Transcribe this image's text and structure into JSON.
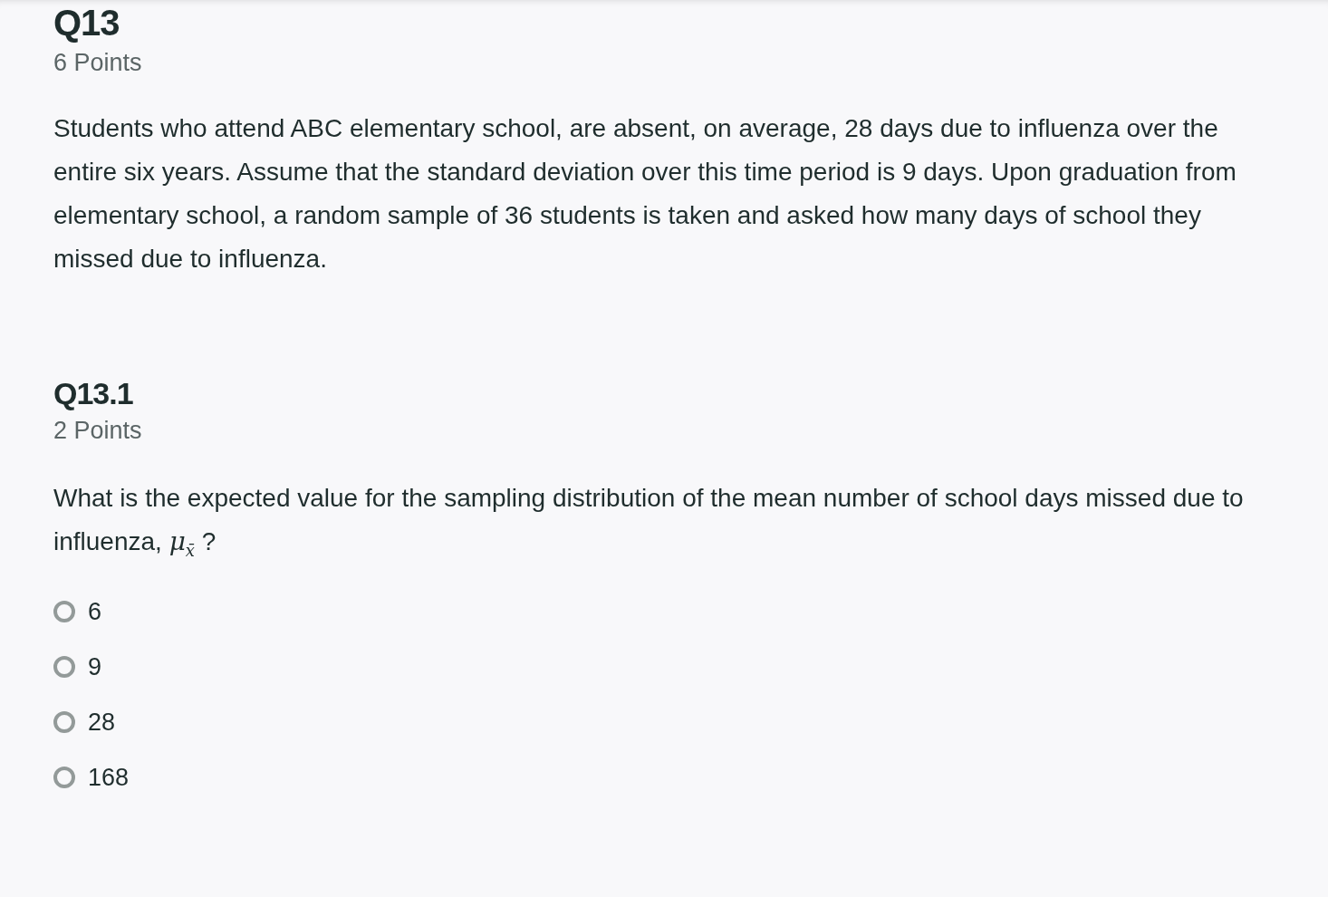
{
  "question": {
    "title": "Q13",
    "points": "6 Points",
    "text": "Students who attend ABC elementary school, are absent, on average, 28 days due to influenza over the entire six years. Assume that the standard deviation over this time period is 9 days. Upon graduation from elementary school, a random sample of 36 students is taken and asked how many days of school they missed due to influenza."
  },
  "subquestion": {
    "title": "Q13.1",
    "points": "2 Points",
    "text": "What is the expected value for the sampling distribution of the mean number of school days missed due to influenza, *μ*$_{x̄}$ ?",
    "options": [
      {
        "label": "6",
        "selected": false
      },
      {
        "label": "9",
        "selected": false
      },
      {
        "label": "28",
        "selected": false
      },
      {
        "label": "168",
        "selected": false
      }
    ]
  }
}
